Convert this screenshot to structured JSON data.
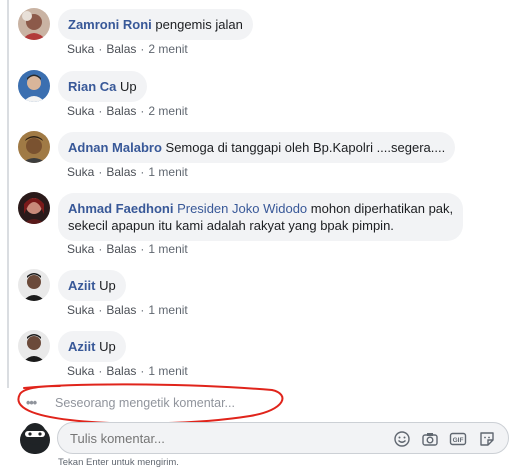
{
  "comments": [
    {
      "author": "Zamroni Roni",
      "text": "pengemis jalan",
      "actions": {
        "like": "Suka",
        "reply": "Balas",
        "time": "2 menit"
      }
    },
    {
      "author": "Rian Ca",
      "text": "Up",
      "actions": {
        "like": "Suka",
        "reply": "Balas",
        "time": "2 menit"
      }
    },
    {
      "author": "Adnan Malabro",
      "text": "Semoga di tanggapi oleh Bp.Kapolri ....segera....",
      "actions": {
        "like": "Suka",
        "reply": "Balas",
        "time": "1 menit"
      }
    },
    {
      "author": "Ahmad Faedhoni",
      "mention": "Presiden Joko Widodo",
      "text_line1": "mohon diperhatikan pak,",
      "text_line2": "sekecil apapun itu kami adalah rakyat yang bpak pimpin.",
      "actions": {
        "like": "Suka",
        "reply": "Balas",
        "time": "1 menit"
      }
    },
    {
      "author": "Aziit",
      "text": "Up",
      "actions": {
        "like": "Suka",
        "reply": "Balas",
        "time": "1 menit"
      }
    },
    {
      "author": "Aziit",
      "text": "Up",
      "actions": {
        "like": "Suka",
        "reply": "Balas",
        "time": "1 menit"
      }
    }
  ],
  "typing_indicator": {
    "dots": "•••",
    "text": "Seseorang mengetik komentar..."
  },
  "composer": {
    "placeholder": "Tulis komentar...",
    "hint": "Tekan Enter untuk mengirim.",
    "icons": [
      "emoji-icon",
      "camera-icon",
      "gif-icon",
      "sticker-icon"
    ],
    "gif_label": "GIF"
  },
  "colors": {
    "author": "#385898",
    "bubble": "#f2f3f5",
    "annotation": "#e0241b"
  }
}
